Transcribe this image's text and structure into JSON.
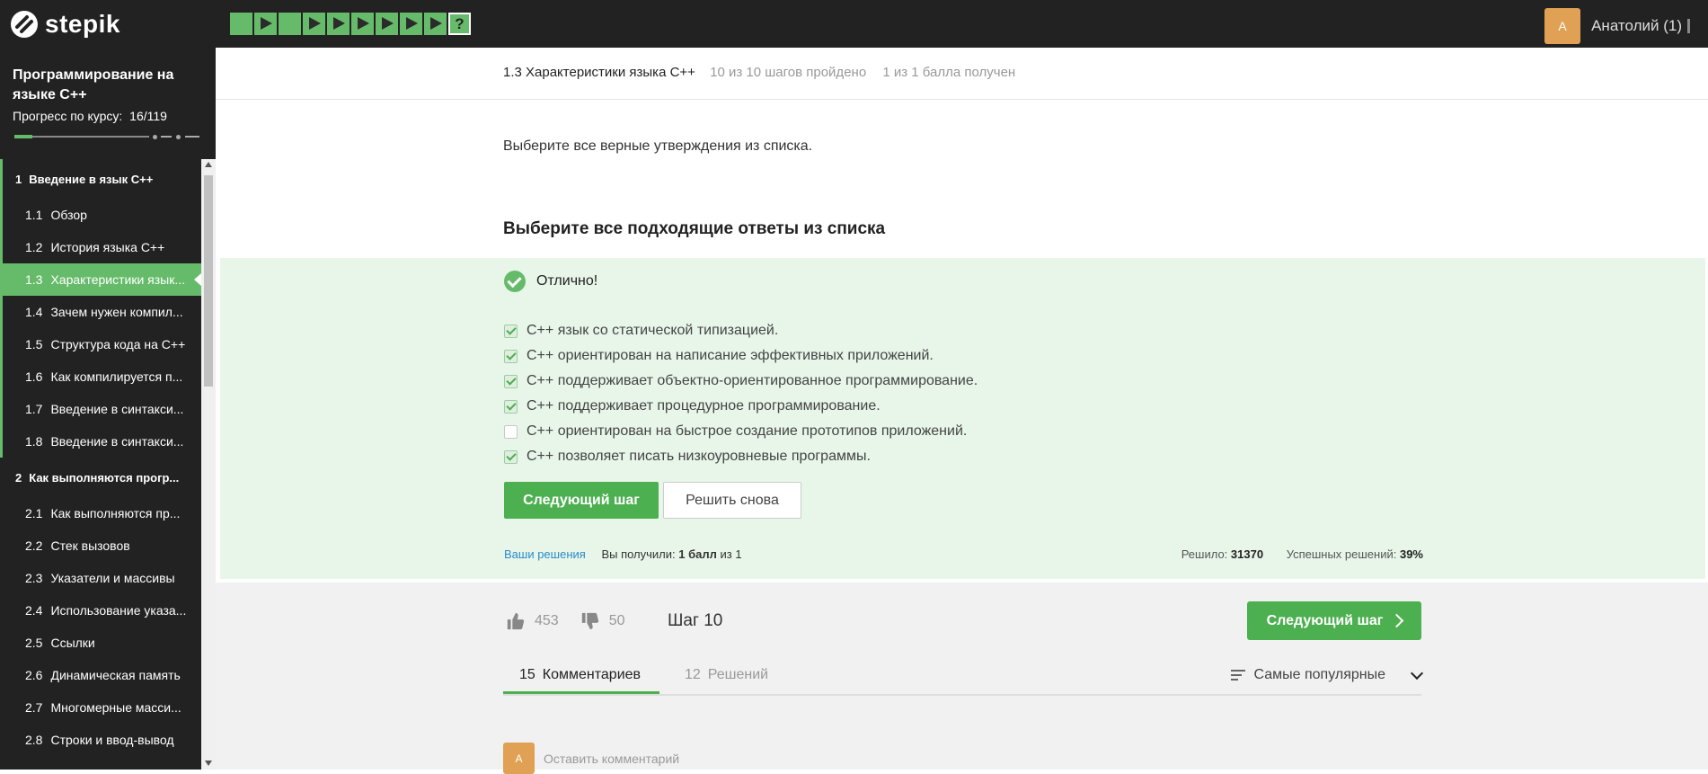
{
  "brand": {
    "name": "stepik"
  },
  "steps": [
    {
      "type": "text",
      "done": true
    },
    {
      "type": "video",
      "done": true
    },
    {
      "type": "text",
      "done": true
    },
    {
      "type": "video",
      "done": true
    },
    {
      "type": "video",
      "done": true
    },
    {
      "type": "video",
      "done": true
    },
    {
      "type": "video",
      "done": true
    },
    {
      "type": "video",
      "done": true
    },
    {
      "type": "video",
      "done": true
    },
    {
      "type": "quiz",
      "done": true,
      "current": true,
      "label": "?"
    }
  ],
  "user": {
    "avatar_letter": "A",
    "name": "Анатолий (1)"
  },
  "course": {
    "title": "Программирование на языке C++",
    "progress_label": "Прогресс по курсу:",
    "progress_value": "16/119",
    "progress_fraction": 0.134
  },
  "toc": [
    {
      "kind": "section",
      "num": "1",
      "label": "Введение в язык C++",
      "done": true
    },
    {
      "kind": "lesson",
      "num": "1.1",
      "label": "Обзор",
      "done": true
    },
    {
      "kind": "lesson",
      "num": "1.2",
      "label": "История языка C++",
      "done": true
    },
    {
      "kind": "lesson",
      "num": "1.3",
      "label": "Характеристики язык...",
      "done": true,
      "active": true
    },
    {
      "kind": "lesson",
      "num": "1.4",
      "label": "Зачем нужен компил...",
      "done": true
    },
    {
      "kind": "lesson",
      "num": "1.5",
      "label": "Структура кода на C++",
      "done": true
    },
    {
      "kind": "lesson",
      "num": "1.6",
      "label": "Как компилируется п...",
      "done": true
    },
    {
      "kind": "lesson",
      "num": "1.7",
      "label": "Введение в синтакси...",
      "done": true
    },
    {
      "kind": "lesson",
      "num": "1.8",
      "label": "Введение в синтакси...",
      "done": true
    },
    {
      "kind": "section",
      "num": "2",
      "label": "Как выполняются прогр...",
      "done": false
    },
    {
      "kind": "lesson",
      "num": "2.1",
      "label": "Как выполняются пр...",
      "done": false
    },
    {
      "kind": "lesson",
      "num": "2.2",
      "label": "Стек вызовов",
      "done": false
    },
    {
      "kind": "lesson",
      "num": "2.3",
      "label": "Указатели и массивы",
      "done": false
    },
    {
      "kind": "lesson",
      "num": "2.4",
      "label": "Использование указа...",
      "done": false
    },
    {
      "kind": "lesson",
      "num": "2.5",
      "label": "Ссылки",
      "done": false
    },
    {
      "kind": "lesson",
      "num": "2.6",
      "label": "Динамическая память",
      "done": false
    },
    {
      "kind": "lesson",
      "num": "2.7",
      "label": "Многомерные масси...",
      "done": false
    },
    {
      "kind": "lesson",
      "num": "2.8",
      "label": "Строки и ввод-вывод",
      "done": false
    }
  ],
  "header": {
    "lesson_title": "1.3 Характеристики языка C++",
    "steps_done": "10 из 10 шагов пройдено",
    "score": "1 из 1 балла  получен"
  },
  "task": {
    "text": "Выберите все верные утверждения из списка.",
    "question_title": "Выберите все подходящие ответы из списка"
  },
  "result": {
    "status": "Отлично!"
  },
  "options": [
    {
      "label": "C++ язык со статической типизацией.",
      "checked": true
    },
    {
      "label": "C++ ориентирован на написание эффективных приложений.",
      "checked": true
    },
    {
      "label": "C++ поддерживает объектно-ориентированное программирование.",
      "checked": true
    },
    {
      "label": "C++ поддерживает процедурное программирование.",
      "checked": true
    },
    {
      "label": "C++ ориентирован на быстрое создание прототипов приложений.",
      "checked": false
    },
    {
      "label": "C++ позволяет писать низкоуровневые программы.",
      "checked": true
    }
  ],
  "buttons": {
    "next_step": "Следующий шаг",
    "retry": "Решить снова"
  },
  "answer_footer": {
    "your_solutions": "Ваши решения",
    "received_label": "Вы получили:",
    "received_value": "1 балл",
    "received_of": "из 1",
    "solved_label": "Решило:",
    "solved_value": "31370",
    "success_label": "Успешных решений:",
    "success_value": "39%"
  },
  "feedback": {
    "likes": "453",
    "dislikes": "50",
    "step_label": "Шаг 10"
  },
  "tabs": [
    {
      "count": "15",
      "label": "Комментариев",
      "active": true
    },
    {
      "count": "12",
      "label": "Решений",
      "active": false
    }
  ],
  "sort": {
    "label": "Самые популярные"
  },
  "comment": {
    "avatar_letter": "A",
    "placeholder": "Оставить комментарий"
  },
  "colors": {
    "accent": "#66bb6a",
    "topbar": "#222222",
    "success_bg": "#e8f6ea",
    "button": "#4caf50"
  }
}
